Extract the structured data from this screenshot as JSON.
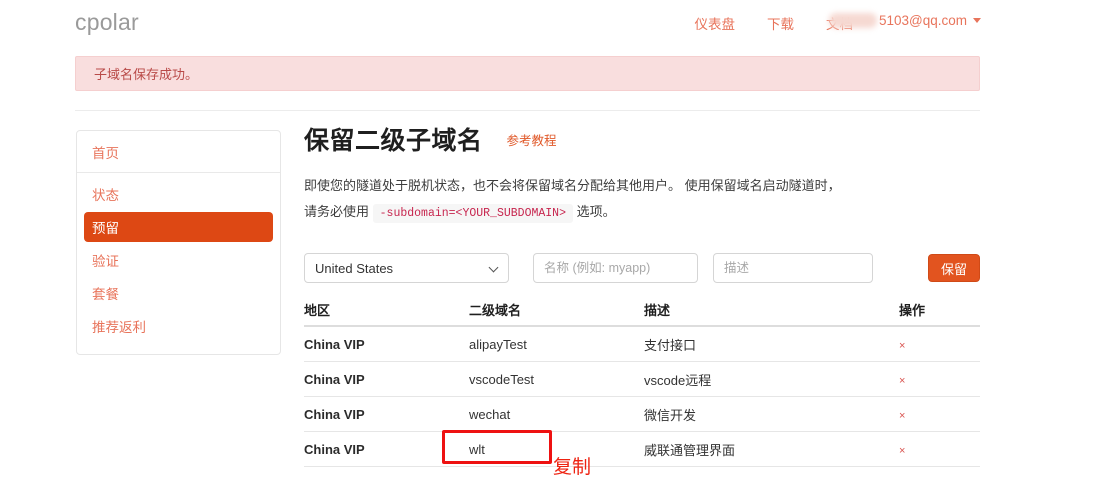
{
  "brand": "cpolar",
  "topnav": {
    "links": [
      "仪表盘",
      "下载",
      "文档"
    ],
    "account_email": "5103@qq.com",
    "caret_icon": "chevron-down-icon"
  },
  "alert": {
    "message": "子域名保存成功。"
  },
  "sidebar": {
    "header": "首页",
    "items": [
      {
        "label": "状态",
        "active": false
      },
      {
        "label": "预留",
        "active": true
      },
      {
        "label": "验证",
        "active": false
      },
      {
        "label": "套餐",
        "active": false
      },
      {
        "label": "推荐返利",
        "active": false
      }
    ]
  },
  "main": {
    "title": "保留二级子域名",
    "tutorial_link": "参考教程",
    "description_part1": "即使您的隧道处于脱机状态，也不会将保留域名分配给其他用户。 使用保留域名启动隧道时，请务必使用",
    "description_code": "-subdomain=<YOUR_SUBDOMAIN>",
    "description_part2": "选项。"
  },
  "form": {
    "region_selected": "United States",
    "name_placeholder": "名称 (例如: myapp)",
    "name_value": "",
    "desc_placeholder": "描述",
    "desc_value": "",
    "reserve_button": "保留"
  },
  "table": {
    "headers": [
      "地区",
      "二级域名",
      "描述",
      "操作"
    ],
    "rows": [
      {
        "region": "China VIP",
        "subdomain": "alipayTest",
        "description": "支付接口",
        "action": "×"
      },
      {
        "region": "China VIP",
        "subdomain": "vscodeTest",
        "description": "vscode远程",
        "action": "×"
      },
      {
        "region": "China VIP",
        "subdomain": "wechat",
        "description": "微信开发",
        "action": "×"
      },
      {
        "region": "China VIP",
        "subdomain": "wlt",
        "description": "威联通管理界面",
        "action": "×"
      }
    ]
  },
  "annotation": {
    "label": "复制",
    "color": "#ee2211"
  },
  "colors": {
    "accent_orange": "#dd4814",
    "link_salmon": "#e8745b",
    "alert_bg": "#f9dede",
    "alert_text": "#b94a48",
    "delete_red": "#d9534f"
  }
}
